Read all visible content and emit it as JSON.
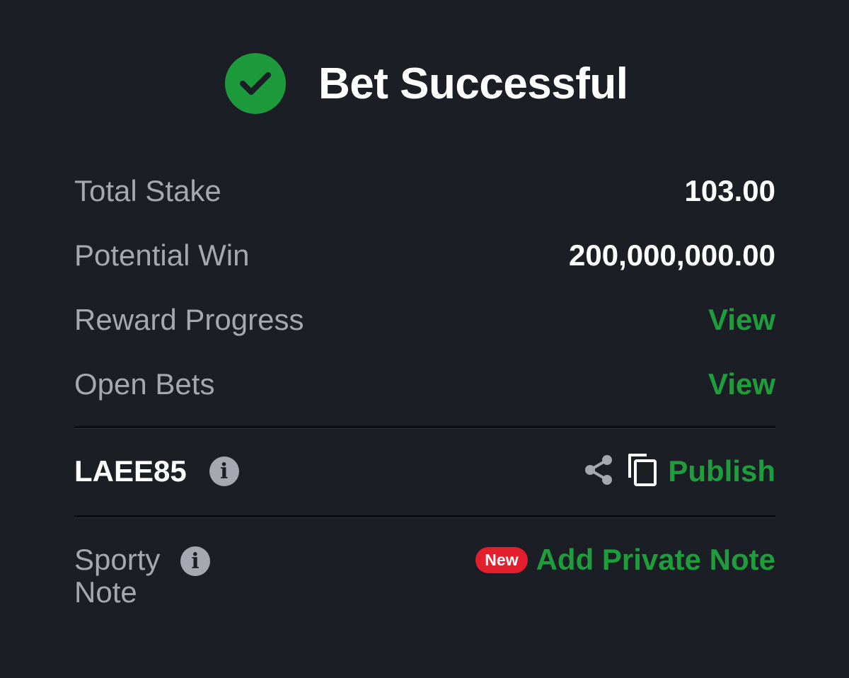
{
  "header": {
    "title": "Bet Successful",
    "icon": "check-circle-icon",
    "accent_color": "#1d9a3b"
  },
  "summary": {
    "total_stake_label": "Total Stake",
    "total_stake_value": "103.00",
    "potential_win_label": "Potential Win",
    "potential_win_value": "200,000,000.00",
    "reward_progress_label": "Reward Progress",
    "reward_progress_link": "View",
    "open_bets_label": "Open Bets",
    "open_bets_link": "View"
  },
  "booking": {
    "code": "LAEE85",
    "info_icon": "info-icon",
    "share_icon": "share-icon",
    "copy_icon": "copy-icon",
    "publish_label": "Publish"
  },
  "note": {
    "label": "Sporty Note",
    "badge": "New",
    "badge_color": "#e41f2d",
    "action_label": "Add Private Note"
  }
}
